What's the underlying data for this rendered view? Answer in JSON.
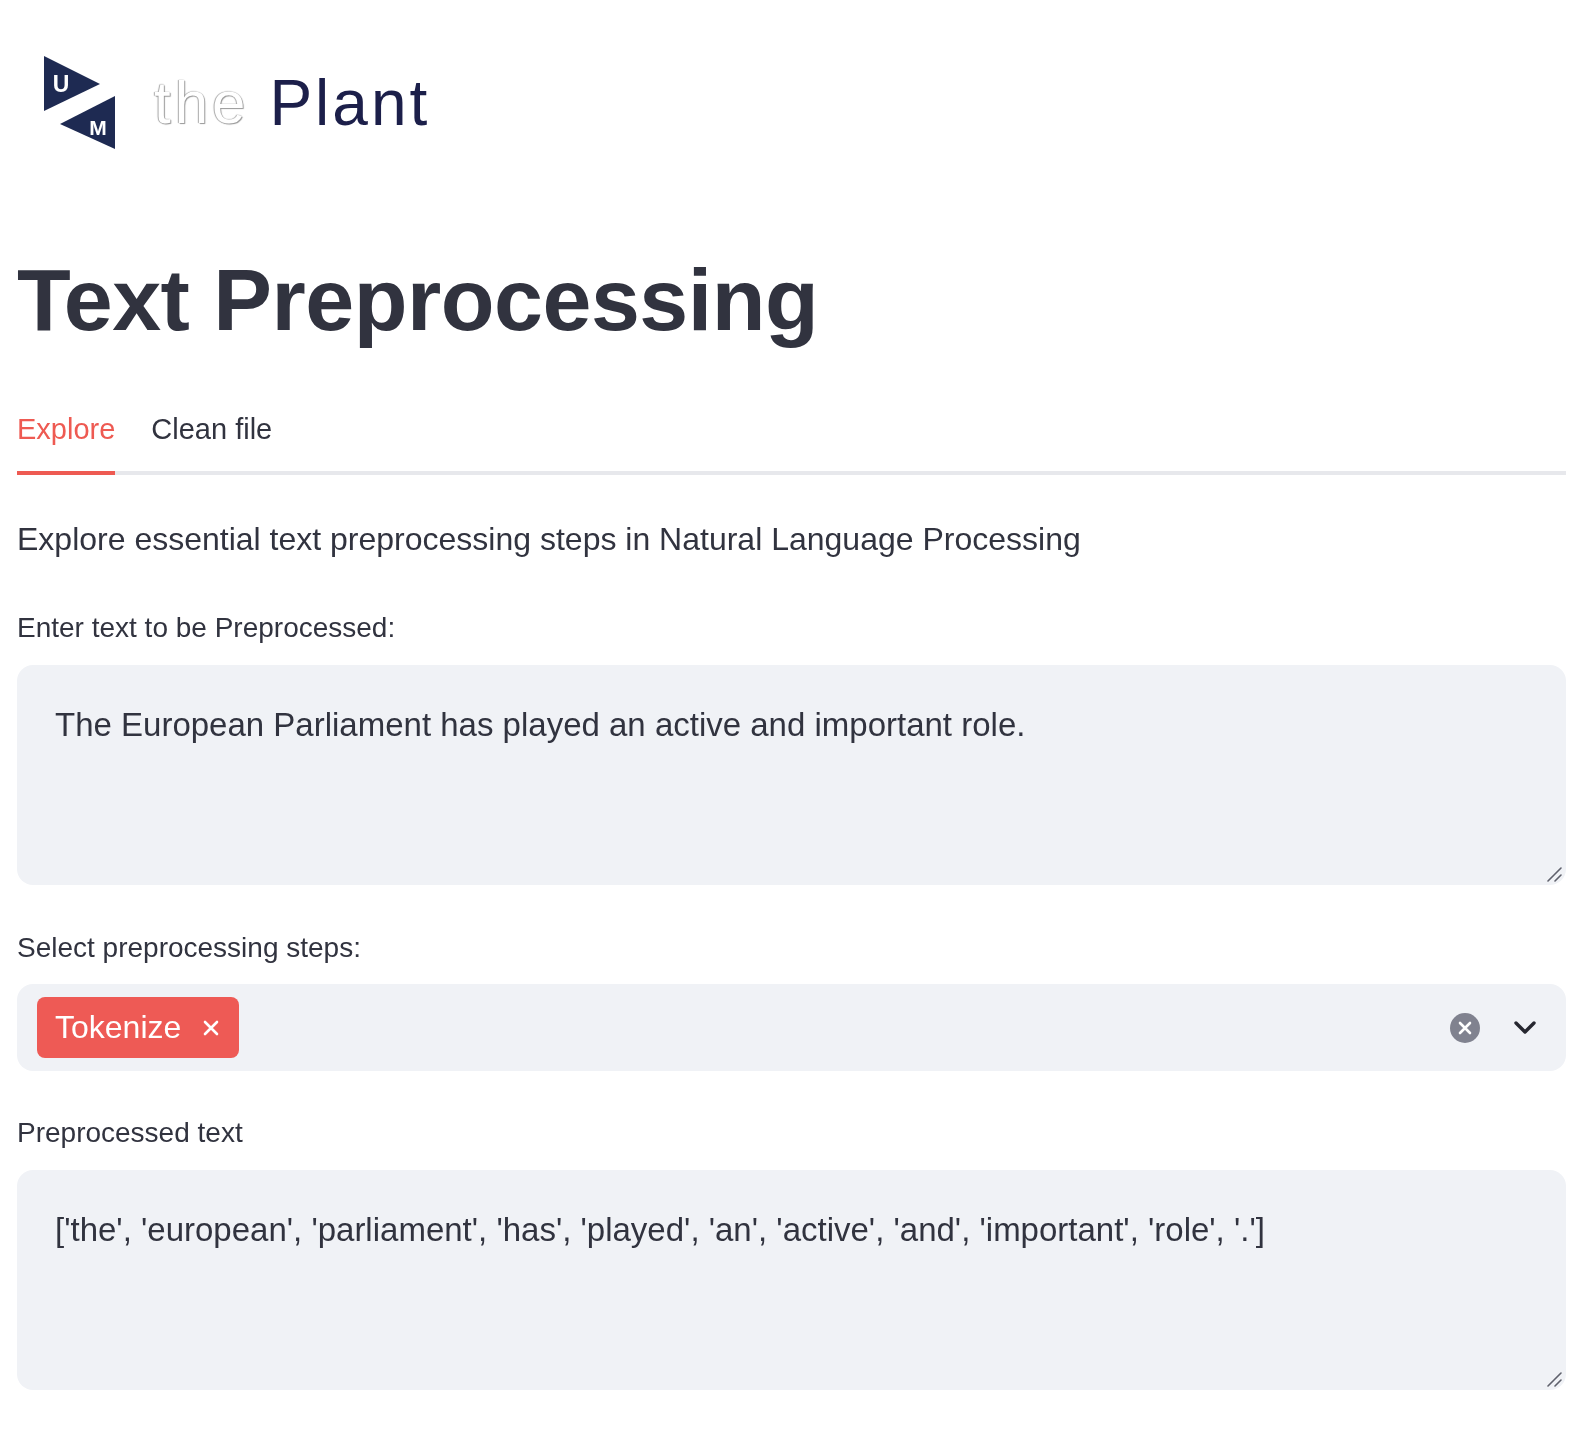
{
  "logo": {
    "mark_letters": [
      "U",
      "M"
    ],
    "faint_word": "the",
    "word": "Plant"
  },
  "title": "Text Preprocessing",
  "tabs": [
    {
      "label": "Explore",
      "selected": true
    },
    {
      "label": "Clean file",
      "selected": false
    }
  ],
  "description": "Explore essential text preprocessing steps in Natural Language Processing",
  "input": {
    "label": "Enter text to be Preprocessed:",
    "value": "The European Parliament has played an active and important role."
  },
  "steps": {
    "label": "Select preprocessing steps:",
    "selected_steps": [
      "Tokenize"
    ]
  },
  "output": {
    "label": "Preprocessed text",
    "value": "['the', 'european', 'parliament', 'has', 'played', 'an', 'active', 'and', 'important', 'role', '.']"
  }
}
